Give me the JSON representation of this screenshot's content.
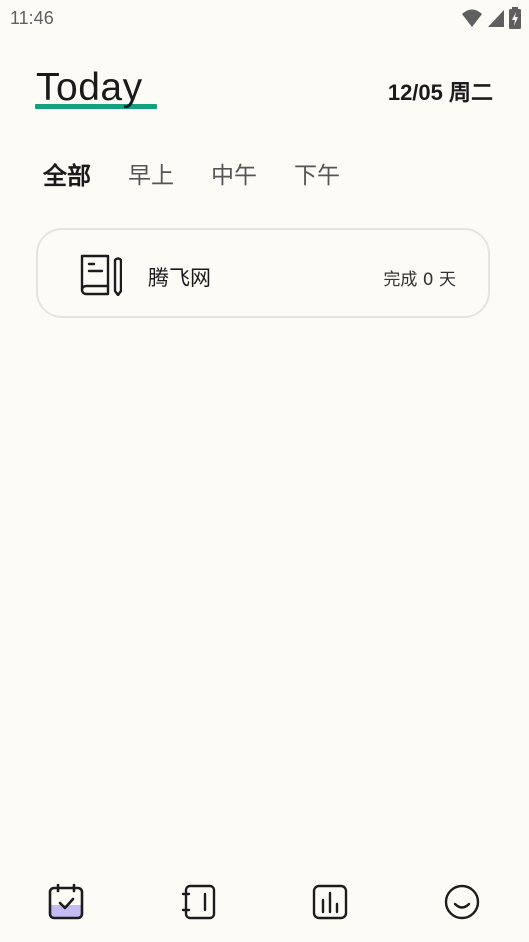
{
  "status_bar": {
    "time": "11:46",
    "icons": [
      "wifi-icon",
      "signal-icon",
      "battery-icon"
    ]
  },
  "header": {
    "title": "Today",
    "date": "12/05 周二",
    "accent_color": "#13a27d"
  },
  "tabs": [
    {
      "label": "全部",
      "active": true
    },
    {
      "label": "早上",
      "active": false
    },
    {
      "label": "中午",
      "active": false
    },
    {
      "label": "下午",
      "active": false
    }
  ],
  "habits": [
    {
      "icon": "book-pencil-icon",
      "name": "腾飞网",
      "status": "完成 0 天"
    }
  ],
  "bottom_nav": {
    "items": [
      {
        "icon": "calendar-check-icon",
        "active": true
      },
      {
        "icon": "notebook-icon",
        "active": false
      },
      {
        "icon": "stats-icon",
        "active": false
      },
      {
        "icon": "smile-icon",
        "active": false
      }
    ],
    "active_fill": "#c5bbf3"
  }
}
